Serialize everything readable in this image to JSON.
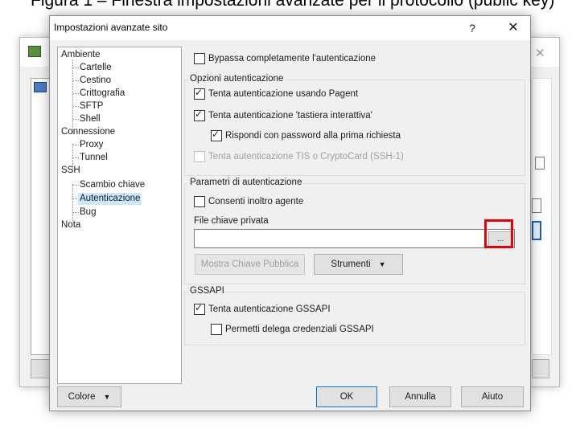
{
  "caption": "Figura 1 – Finestra impostazioni avanzate per il protocollo (public key)",
  "dialog": {
    "title": "Impostazioni avanzate sito",
    "help_label": "?",
    "close_label": "✕"
  },
  "tree": {
    "items": [
      {
        "label": "Ambiente",
        "level": 0
      },
      {
        "label": "Cartelle",
        "level": 1
      },
      {
        "label": "Cestino",
        "level": 1
      },
      {
        "label": "Crittografia",
        "level": 1
      },
      {
        "label": "SFTP",
        "level": 1
      },
      {
        "label": "Shell",
        "level": 1
      },
      {
        "label": "Connessione",
        "level": 0
      },
      {
        "label": "Proxy",
        "level": 1
      },
      {
        "label": "Tunnel",
        "level": 1
      },
      {
        "label": "SSH",
        "level": 0
      },
      {
        "label": "Scambio chiave",
        "level": 1
      },
      {
        "label": "Autenticazione",
        "level": 1,
        "selected": true
      },
      {
        "label": "Bug",
        "level": 1
      },
      {
        "label": "Nota",
        "level": 0
      }
    ]
  },
  "bypass_auth": {
    "label": "Bypassa completamente l'autenticazione",
    "checked": false
  },
  "auth_options": {
    "title": "Opzioni autenticazione",
    "pagent": {
      "label": "Tenta autenticazione usando Pagent",
      "checked": true
    },
    "keyboard_interactive": {
      "label": "Tenta autenticazione 'tastiera interattiva'",
      "checked": true
    },
    "respond_password": {
      "label": "Rispondi con password alla prima richiesta",
      "checked": true
    },
    "tis_cryptocard": {
      "label": "Tenta autenticazione TIS o CryptoCard (SSH-1)",
      "checked": false
    }
  },
  "auth_params": {
    "title": "Parametri di autenticazione",
    "agent_forwarding": {
      "label": "Consenti inoltro agente",
      "checked": false
    },
    "private_key_label": "File chiave privata",
    "private_key_value": "",
    "browse_label": "...",
    "show_public_key_label": "Mostra Chiave Pubblica",
    "tools_label": "Strumenti"
  },
  "gssapi": {
    "title": "GSSAPI",
    "try_gssapi": {
      "label": "Tenta autenticazione GSSAPI",
      "checked": true
    },
    "delegate": {
      "label": "Permetti delega credenziali GSSAPI",
      "checked": false
    }
  },
  "footer": {
    "color_label": "Colore",
    "ok_label": "OK",
    "cancel_label": "Annulla",
    "help_label": "Aiuto"
  },
  "colors": {
    "highlight": "#e8000b",
    "selection": "#cce8ff"
  }
}
